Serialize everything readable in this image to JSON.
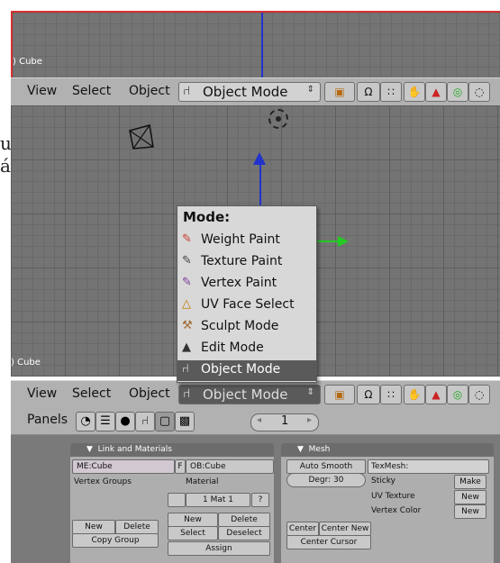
{
  "left_strip": {
    "text1": "u",
    "text2": "á"
  },
  "top_viewport": {
    "object_label": ") Cube"
  },
  "main_viewport": {
    "object_label": ") Cube"
  },
  "header_menu": {
    "view": "View",
    "select": "Select",
    "object": "Object"
  },
  "top_header": {
    "mode_label": "Object Mode"
  },
  "bottom_header": {
    "mode_label": "Object Mode"
  },
  "mode_popup": {
    "title": "Mode:",
    "items": [
      {
        "label": "Weight Paint",
        "icon": "weight-paint-icon"
      },
      {
        "label": "Texture Paint",
        "icon": "texture-paint-icon"
      },
      {
        "label": "Vertex Paint",
        "icon": "vertex-paint-icon"
      },
      {
        "label": "UV Face Select",
        "icon": "uv-face-select-icon"
      },
      {
        "label": "Sculpt Mode",
        "icon": "sculpt-mode-icon"
      },
      {
        "label": "Edit Mode",
        "icon": "edit-mode-icon"
      },
      {
        "label": "Object Mode",
        "icon": "object-mode-icon",
        "active": true
      }
    ]
  },
  "buttons_window": {
    "panels_label": "Panels",
    "frame_number": "1",
    "link_materials": {
      "title": "Link and Materials",
      "me_field": "ME:Cube",
      "f_label": "F",
      "ob_field": "OB:Cube",
      "vertex_groups": "Vertex Groups",
      "material": "Material",
      "mat_value": "1 Mat 1",
      "q": "?",
      "new1": "New",
      "delete1": "Delete",
      "copy_group": "Copy Group",
      "new2": "New",
      "delete2": "Delete",
      "select": "Select",
      "deselect": "Deselect",
      "assign": "Assign"
    },
    "mesh": {
      "title": "Mesh",
      "auto_smooth": "Auto Smooth",
      "degr": "Degr: 30",
      "texmesh": "TexMesh:",
      "sticky": "Sticky",
      "make": "Make",
      "uv_texture": "UV Texture",
      "new_uv": "New",
      "vertex_color": "Vertex Color",
      "new_vc": "New",
      "center": "Center",
      "center_new": "Center New",
      "center_cursor": "Center Cursor"
    }
  },
  "colors": {
    "border_red": "#d63030",
    "z_axis": "#2233cc",
    "y_axis": "#22cc22"
  }
}
